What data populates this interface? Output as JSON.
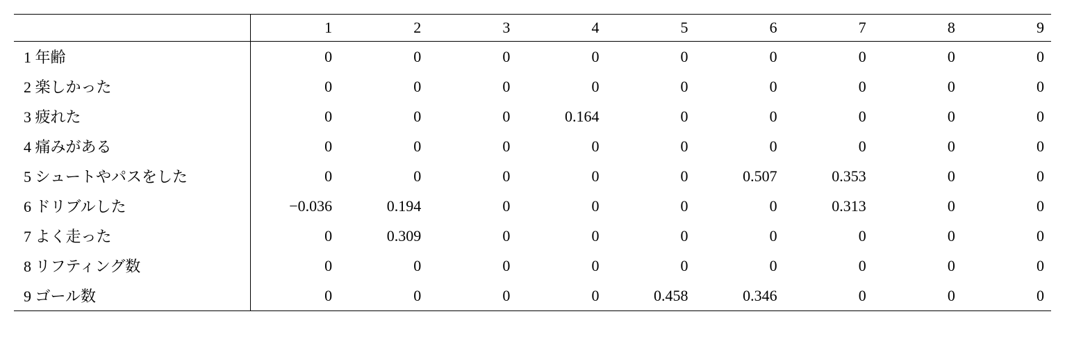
{
  "chart_data": {
    "type": "table",
    "col_headers": [
      "1",
      "2",
      "3",
      "4",
      "5",
      "6",
      "7",
      "8",
      "9"
    ],
    "rows": [
      {
        "label": "1 年齢",
        "values": [
          "0",
          "0",
          "0",
          "0",
          "0",
          "0",
          "0",
          "0",
          "0"
        ]
      },
      {
        "label": "2 楽しかった",
        "values": [
          "0",
          "0",
          "0",
          "0",
          "0",
          "0",
          "0",
          "0",
          "0"
        ]
      },
      {
        "label": "3 疲れた",
        "values": [
          "0",
          "0",
          "0",
          "0.164",
          "0",
          "0",
          "0",
          "0",
          "0"
        ]
      },
      {
        "label": "4 痛みがある",
        "values": [
          "0",
          "0",
          "0",
          "0",
          "0",
          "0",
          "0",
          "0",
          "0"
        ]
      },
      {
        "label": "5 シュートやパスをした",
        "values": [
          "0",
          "0",
          "0",
          "0",
          "0",
          "0.507",
          "0.353",
          "0",
          "0"
        ]
      },
      {
        "label": "6 ドリブルした",
        "values": [
          "−0.036",
          "0.194",
          "0",
          "0",
          "0",
          "0",
          "0.313",
          "0",
          "0"
        ]
      },
      {
        "label": "7 よく走った",
        "values": [
          "0",
          "0.309",
          "0",
          "0",
          "0",
          "0",
          "0",
          "0",
          "0"
        ]
      },
      {
        "label": "8 リフティング数",
        "values": [
          "0",
          "0",
          "0",
          "0",
          "0",
          "0",
          "0",
          "0",
          "0"
        ]
      },
      {
        "label": "9 ゴール数",
        "values": [
          "0",
          "0",
          "0",
          "0",
          "0.458",
          "0.346",
          "0",
          "0",
          "0"
        ]
      }
    ]
  }
}
